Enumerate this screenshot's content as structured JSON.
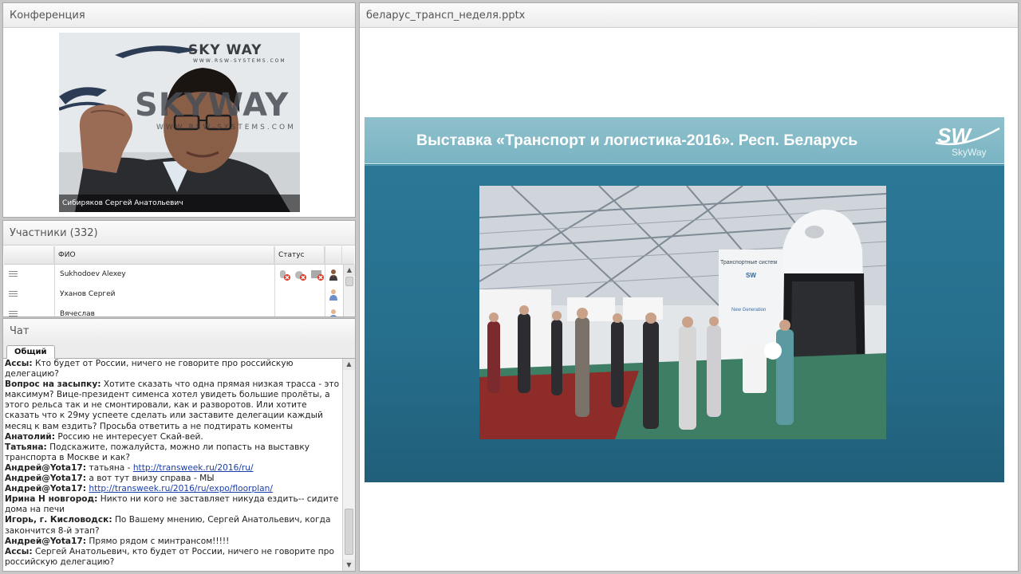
{
  "conference": {
    "title": "Конференция",
    "video_caption": "Сибиряков Сергей  Анатольевич",
    "watermarks": [
      "SKY WAY",
      "WWW.RSW-SYSTEMS.COM",
      "SKYWAY",
      "WWW.RSW-SYSTEMS.COM"
    ]
  },
  "participants": {
    "title": "Участники (332)",
    "columns": [
      "ФИО",
      "Статус"
    ],
    "rows": [
      {
        "name": "Sukhodoev Alexey",
        "status_icons": [
          "mic-off-icon",
          "camera-off-icon",
          "screen-off-icon"
        ],
        "role_icon": "presenter-icon"
      },
      {
        "name": "Уханов Сергей",
        "status_icons": [],
        "role_icon": "user-icon"
      },
      {
        "name": "Вячеслав",
        "status_icons": [],
        "role_icon": "user-icon"
      }
    ]
  },
  "chat": {
    "title": "Чат",
    "tab": "Общий",
    "messages": [
      {
        "author": "Ассы:",
        "text": "Кто будет от России, ничего не говорите про российскую делегацию?"
      },
      {
        "author": "Вопрос на засыпку:",
        "text": "Хотите сказать что одна прямая низкая трасса - это максимум? Вице-президент сименса хотел увидеть большие пролёты, а этого рельса так и не смонтировали, как и разворотов. Или хотите сказать что к 29му успеете сделать или заставите делегации каждый месяц к вам ездить? Просьба ответить а не подтирать коменты"
      },
      {
        "author": "Анатолий:",
        "text": "Россию не интересует Скай-вей."
      },
      {
        "author": "Татьяна:",
        "text": "Подскажите, пожалуйста, можно ли попасть на выставку транспорта в Москве и как?"
      },
      {
        "author": "Андрей@Yota17:",
        "text": "татьяна - ",
        "link": "http://transweek.ru/2016/ru/"
      },
      {
        "author": "Андрей@Yota17:",
        "text": "а вот тут внизу справа - МЫ"
      },
      {
        "author": "Андрей@Yota17:",
        "text": "",
        "link": "http://transweek.ru/2016/ru/expo/floorplan/"
      },
      {
        "author": "Ирина Н новгород:",
        "text": "Никто ни кого не заставляет никуда ездить-- сидите дома на печи"
      },
      {
        "author": "Игорь, г. Кисловодск:",
        "text": "По Вашему мнению, Сергей Анатольевич, когда закончится 8-й этап?"
      },
      {
        "author": "Андрей@Yota17:",
        "text": "Прямо рядом с минтрансом!!!!!"
      },
      {
        "author": "Ассы:",
        "text": "Сергей Анатольевич, кто будет от России, ничего не говорите про российскую делегацию?"
      }
    ]
  },
  "document": {
    "title": "беларус_трансп_неделя.pptx",
    "slide": {
      "title": "Выставка «Транспорт и логистика-2016». Респ. Беларусь",
      "logo_mark": "SW",
      "logo_text": "SkyWay",
      "photo_signage": [
        "Транспортные систем",
        "New Generation",
        "SW"
      ]
    }
  },
  "colors": {
    "slide_header": "#8fc0cc",
    "slide_body": "#2c7a99",
    "link": "#1a3ea8",
    "panel_border": "#a9a9a9"
  }
}
